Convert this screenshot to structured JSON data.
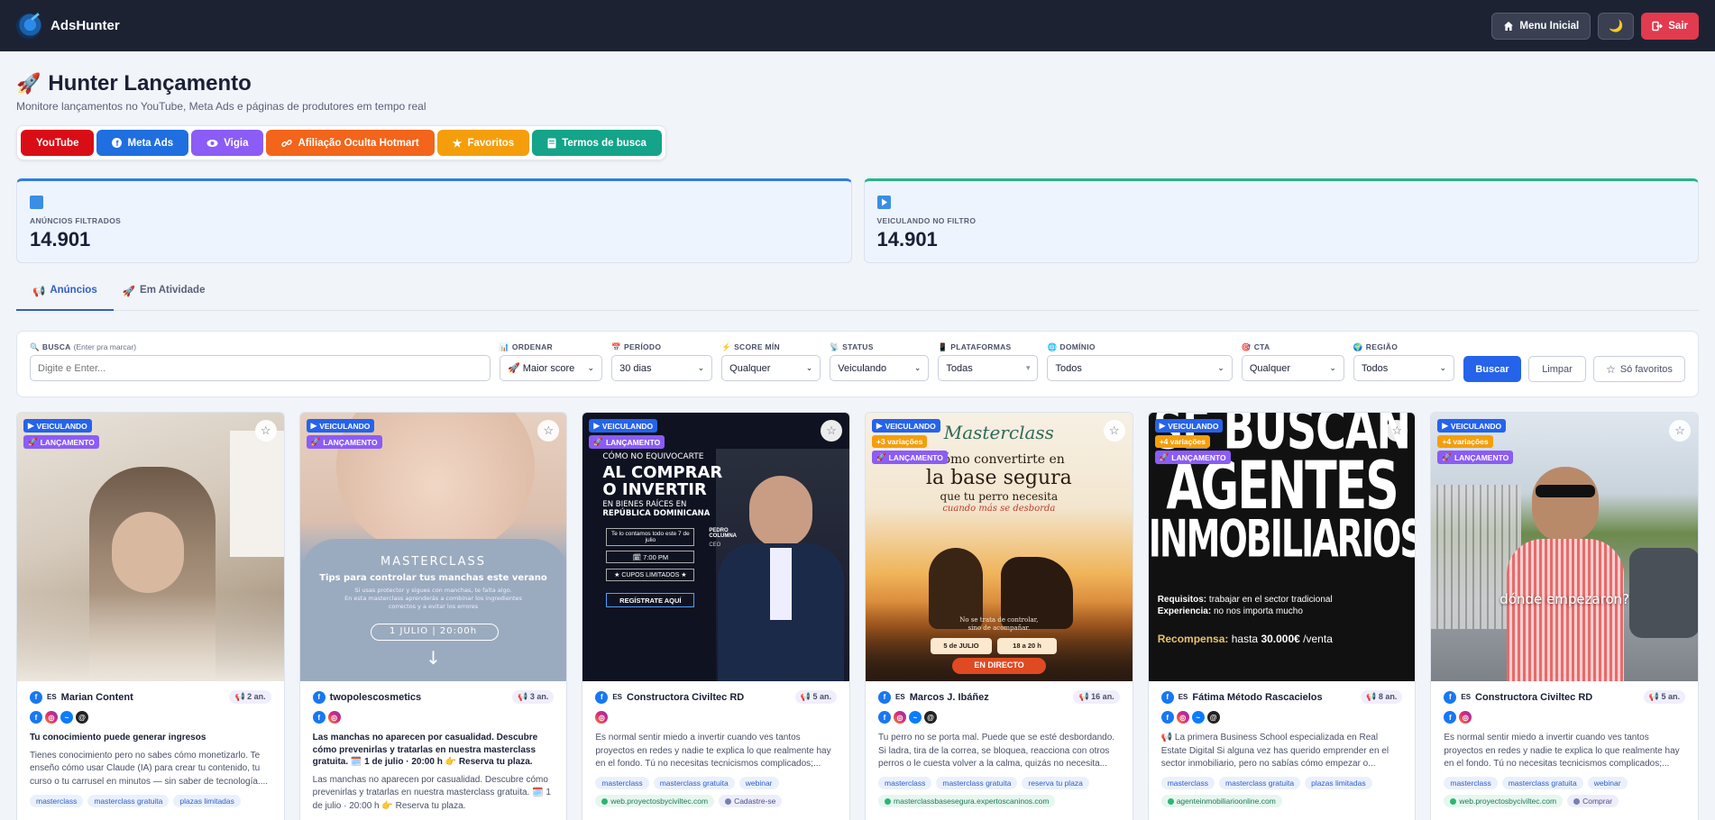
{
  "app": {
    "name": "AdsHunter"
  },
  "topbar": {
    "menu_label": "Menu Inicial",
    "theme_icon": "moon-icon",
    "logout_label": "Sair"
  },
  "header": {
    "title": "Hunter Lançamento",
    "subtitle": "Monitore lançamentos no YouTube, Meta Ads e páginas de produtores em tempo real"
  },
  "pills": [
    {
      "label": "YouTube",
      "color": "#d90d16"
    },
    {
      "label": "Meta Ads",
      "color": "#1f6fe0"
    },
    {
      "label": "Vigia",
      "color": "#8b5cf6"
    },
    {
      "label": "Afiliação Oculta Hotmart",
      "color": "#f2651a"
    },
    {
      "label": "Favoritos",
      "color": "#f59e0b"
    },
    {
      "label": "Termos de busca",
      "color": "#14a48a"
    }
  ],
  "stats": [
    {
      "label": "ANÚNCIOS FILTRADOS",
      "value": "14.901"
    },
    {
      "label": "VEICULANDO NO FILTRO",
      "value": "14.901"
    }
  ],
  "tabs": [
    {
      "label": "Anúncios"
    },
    {
      "label": "Em Atividade"
    }
  ],
  "filters": {
    "busca": {
      "label": "BUSCA",
      "hint": "(Enter pra marcar)",
      "placeholder": "Digite e Enter..."
    },
    "ordenar": {
      "label": "ORDENAR",
      "value": "Maior score"
    },
    "periodo": {
      "label": "PERÍODO",
      "value": "30 dias"
    },
    "score": {
      "label": "SCORE MÍN",
      "value": "Qualquer"
    },
    "status": {
      "label": "STATUS",
      "value": "Veiculando"
    },
    "plataformas": {
      "label": "PLATAFORMAS",
      "value": "Todas"
    },
    "dominio": {
      "label": "DOMÍNIO",
      "value": "Todos"
    },
    "cta": {
      "label": "CTA",
      "value": "Qualquer"
    },
    "regiao": {
      "label": "REGIÃO",
      "value": "Todos"
    },
    "buscar_label": "Buscar",
    "limpar_label": "Limpar",
    "favoritos_label": "Só favoritos"
  },
  "cards": [
    {
      "badges": [
        "VEICULANDO",
        "LANÇAMENTO"
      ],
      "lang": "ES",
      "author": "Marian Content",
      "age": "2 an.",
      "platforms": [
        "facebook",
        "instagram",
        "messenger",
        "threads"
      ],
      "title": "Tu conocimiento puede generar ingresos",
      "text": "Tienes conocimiento pero no sabes cómo monetizarlo. Te enseño cómo usar Claude (IA) para crear tu contenido, tu curso o tu carrusel en minutos — sin saber de tecnología....",
      "tags": [
        "masterclass",
        "masterclass gratuita",
        "plazas limitadas"
      ],
      "domain": "",
      "cta": ""
    },
    {
      "badges": [
        "VEICULANDO",
        "LANÇAMENTO"
      ],
      "lang": "ES",
      "author": "twopolescosmetics",
      "age": "3 an.",
      "platforms": [
        "facebook",
        "instagram"
      ],
      "title": "Las manchas no aparecen por casualidad. Descubre cómo prevenirlas y tratarlas en nuestra masterclass gratuita. 🗓️ 1 de julio · 20:00 h 👉 Reserva tu plaza.",
      "text": "Las manchas no aparecen por casualidad. Descubre cómo prevenirlas y tratarlas en nuestra masterclass gratuita. 🗓️ 1 de julio · 20:00 h 👉 Reserva tu plaza.",
      "tags": [],
      "domain": "",
      "cta": "",
      "img": {
        "title": "MASTERCLASS",
        "line1": "Tips para controlar tus manchas este verano",
        "line2": "Si usas protector y sigues con manchas, te falta algo.",
        "line3": "En esta masterclass aprenderás a combinar los ingredientes",
        "line4": "correctos y a evitar los errores",
        "date": "1 JULIO | 20:00h"
      }
    },
    {
      "badges": [
        "VEICULANDO",
        "LANÇAMENTO"
      ],
      "lang": "ES",
      "author": "Constructora Civiltec RD",
      "age": "5 an.",
      "platforms": [
        "instagram"
      ],
      "title": "",
      "text": "Es normal sentir miedo a invertir cuando ves tantos proyectos en redes y nadie te explica lo que realmente hay en el fondo. Tú no necesitas tecnicismos complicados;...",
      "tags": [
        "masterclass",
        "masterclass gratuita",
        "webinar"
      ],
      "domain": "web.proyectosbyciviltec.com",
      "cta": "Cadastre-se",
      "img": {
        "l1": "CÓMO NO EQUIVOCARTE",
        "l2": "AL COMPRAR",
        "l3": "O INVERTIR",
        "l4": "EN BIENES RAÍCES EN",
        "l5": "REPÚBLICA DOMINICANA",
        "b1": "Te lo contamos todo este 7 de julio",
        "b2": "🗓 7:00 PM",
        "b3": "★ CUPOS LIMITADOS ★",
        "b4": "REGÍSTRATE AQUÍ",
        "name": "PEDRO COLUMNA",
        "role": "CEO"
      }
    },
    {
      "badges": [
        "VEICULANDO",
        "+3 variações",
        "LANÇAMENTO"
      ],
      "lang": "ES",
      "author": "Marcos J. Ibáñez",
      "age": "16 an.",
      "platforms": [
        "facebook",
        "instagram",
        "messenger",
        "threads"
      ],
      "title": "",
      "text": "Tu perro no se porta mal. Puede que se esté desbordando. Si ladra, tira de la correa, se bloquea, reacciona con otros perros o le cuesta volver a la calma, quizás no necesita...",
      "tags": [
        "masterclass",
        "masterclass gratuita",
        "reserva tu plaza"
      ],
      "domain": "masterclassbasesegura.expertoscaninos.com",
      "cta": "",
      "img": {
        "head": "Masterclass",
        "l1": "Cómo convertirte en",
        "l2": "la base segura",
        "l3": "que tu perro necesita",
        "l4": "cuando más se desborda",
        "l5": "No se trata de controlar,",
        "l6": "sino de acompañar.",
        "d1": "5 de JULIO",
        "d2": "18 a 20 h",
        "live": "EN DIRECTO"
      }
    },
    {
      "badges": [
        "VEICULANDO",
        "+4 variações",
        "LANÇAMENTO"
      ],
      "lang": "ES",
      "author": "Fátima Método Rascacielos",
      "age": "8 an.",
      "platforms": [
        "facebook",
        "instagram",
        "messenger",
        "threads"
      ],
      "title": "",
      "text": "📢 La primera Business School especializada en Real Estate Digital Si alguna vez has querido emprender en el sector inmobiliario, pero no sabías cómo empezar o...",
      "tags": [
        "masterclass",
        "masterclass gratuita",
        "plazas limitadas"
      ],
      "domain": "agenteinmobiliarioonline.com",
      "cta": "",
      "img": {
        "l1": "SE BUSCAN",
        "l2": "AGENTES",
        "l3": "INMOBILIARIOS",
        "r1a": "Requisitos:",
        "r1b": "trabajar en el sector tradicional",
        "r2a": "Experiencia:",
        "r2b": "no nos importa mucho",
        "r3a": "Recompensa:",
        "r3b": "hasta",
        "r3c": "30.000€",
        "r3d": "/venta"
      }
    },
    {
      "badges": [
        "VEICULANDO",
        "+4 variações",
        "LANÇAMENTO"
      ],
      "lang": "ES",
      "author": "Constructora Civiltec RD",
      "age": "5 an.",
      "platforms": [
        "facebook",
        "instagram"
      ],
      "title": "",
      "text": "Es normal sentir miedo a invertir cuando ves tantos proyectos en redes y nadie te explica lo que realmente hay en el fondo. Tú no necesitas tecnicismos complicados;...",
      "tags": [
        "masterclass",
        "masterclass gratuita",
        "webinar"
      ],
      "domain": "web.proyectosbyciviltec.com",
      "cta": "Comprar",
      "img": {
        "caption": "dónde empezaron?"
      }
    }
  ]
}
